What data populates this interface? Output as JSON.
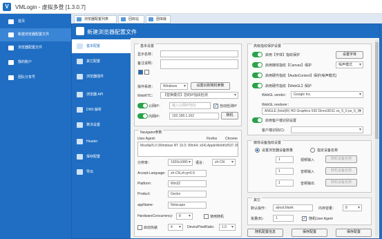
{
  "app": {
    "title": "VMLogin - 虚拟多登 [1.3.0.7]"
  },
  "outer_sidebar": [
    {
      "label": "首页"
    },
    {
      "label": "新建浏览器配置文件"
    },
    {
      "label": "浏览器配置文件"
    },
    {
      "label": "我的账户"
    },
    {
      "label": "团队分享号"
    }
  ],
  "outer_tabs": [
    {
      "label": "浏览器配置列表"
    },
    {
      "label": "回收站"
    },
    {
      "label": "团体版"
    }
  ],
  "dialog": {
    "title": "新建浏览器配置文件",
    "sidebar": [
      {
        "label": "基本配置"
      },
      {
        "label": "其它配置"
      },
      {
        "label": "浏览器插件"
      },
      {
        "label": "浏览器 API"
      },
      {
        "label": "DNS 解析"
      },
      {
        "label": "算法设置"
      },
      {
        "label": "Header"
      },
      {
        "label": "保存配置"
      },
      {
        "label": "导出"
      }
    ]
  },
  "basic": {
    "title": "基本设置",
    "name_label": "显示名称：",
    "note_label": "备注说明：",
    "os_label": "操作系统：",
    "os_value": "Windows",
    "random_btn": "设置识别随机参数",
    "webrtc_label": "WebRTC：",
    "webrtc_value": "【替换模式】您的IP指纹检测",
    "proxy_label": "公网IP：",
    "proxy_placeholder": "输入公网IP地址",
    "auto_detect": "自动检测IP",
    "inner_label": "内网IP：",
    "inner_value": "192.168.1.162",
    "random_short": "随机"
  },
  "navigator": {
    "title": "Navigator参数",
    "ua_label": "User Agent:",
    "ua_value": "Mozilla/5.0 (Windows NT 10.0; Win64; x64) AppleWebKit/537.36 (KHT",
    "ua_col1": "Firefox",
    "ua_col2": "Chrome",
    "res_label": "分辨率：",
    "res_value": "1920x1080",
    "lang_label": "语言：",
    "lang_value": "zh-CN",
    "accept_label": "Accept-Language:",
    "accept_value": "zh-CN,zh;q=0.9",
    "platform_label": "Platform:",
    "platform_value": "Win32",
    "product_label": "Product:",
    "product_value": "Gecko",
    "appname_label": "appName:",
    "appname_value": "Netscape",
    "hw_label": "HardwareConcurrency:",
    "hw_value": "8",
    "hw_check": "使用随机",
    "touch_label": "启动伪装",
    "touch_value": "4",
    "dpr_label": "DevicePixelRatio:",
    "dpr_value": "1.0"
  },
  "fingerprint": {
    "title": "高级指纹保护设置",
    "rows": [
      {
        "label": "启用【字体】指纹保护",
        "btn": "设置字体"
      },
      {
        "label": "启用媒体指纹【Canvas】保护",
        "btn": "噪声模式"
      },
      {
        "label": "启用硬件指纹【AudioContext】保护(噪声模式)"
      },
      {
        "label": "启用硬件指纹【WebGL】保护"
      }
    ],
    "vendor_label": "WebGL vendor：",
    "vendor_value": "Google Inc.",
    "renderer_label": "WebGL renderer：",
    "renderer_value": "ANGLE (Intel(R) HD Graphics 530 Direct3D11 vs_5_0 ps_5_0)",
    "client_label": "启用客户端识别设置",
    "client_sub_label": "客户端识别(C):",
    "client_value": ""
  },
  "media": {
    "title": "媒体设备指纹设置",
    "opt1": "设置浏览器设备数量",
    "opt2": "指定设备名称",
    "rows": [
      {
        "value": "1",
        "label": "视频输入",
        "btn": "随机设备名称"
      },
      {
        "value": "1",
        "label": "音频输入",
        "btn": "随机设备名称"
      },
      {
        "value": "1",
        "label": "音频输出",
        "btn": "随机设备名称"
      }
    ]
  },
  "other": {
    "title": "其它",
    "startup_label": "默认操作：",
    "startup_value": "about:blank",
    "memory_label": "内存容量：",
    "memory_value": "8",
    "batch_label": "批量(B)：",
    "batch_value": "1",
    "random_ua": "随机User Agent"
  },
  "footer": {
    "btn1": "随机配置信息",
    "btn2": "保存配置",
    "btn3": "保存配置"
  }
}
